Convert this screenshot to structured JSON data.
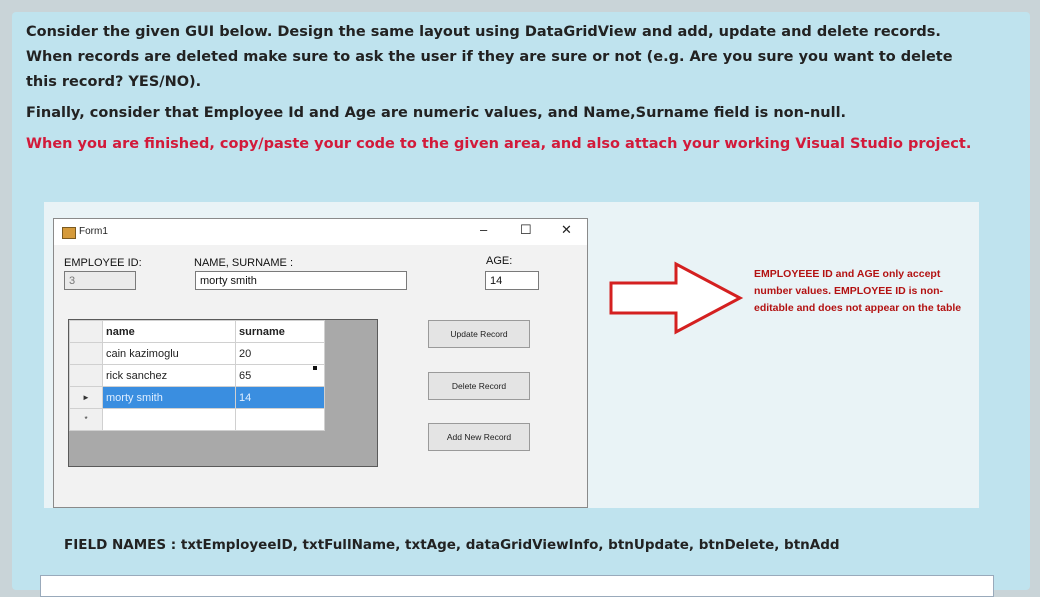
{
  "question": {
    "line1": "Consider the given GUI below. Design the same layout using DataGridView and add, update and delete records. When records are deleted make sure to ask the user if they are sure or not (e.g. Are you sure you want to delete this record? YES/NO).",
    "line2": "Finally, consider that Employee Id and Age are numeric values, and Name,Surname field is non-null.",
    "line3": "When you are finished, copy/paste your code to the given area, and also attach your working Visual Studio project."
  },
  "form": {
    "title": "Form1",
    "minimize": "–",
    "maximize": "☐",
    "close": "✕",
    "employee_id_label": "EMPLOYEE ID:",
    "employee_id_value": "3",
    "name_label": "NAME, SURNAME :",
    "name_value": "morty smith",
    "age_label": "AGE:",
    "age_value": "14",
    "grid": {
      "headers": [
        "name",
        "surname"
      ],
      "rows": [
        [
          "cain kazimoglu",
          "20"
        ],
        [
          "rick sanchez",
          "65"
        ],
        [
          "morty smith",
          "14"
        ],
        [
          "",
          ""
        ]
      ],
      "selected_marker": "►",
      "new_row_marker": "*"
    },
    "buttons": {
      "update": "Update Record",
      "delete": "Delete Record",
      "add": "Add New Record"
    }
  },
  "note": "EMPLOYEEE ID and AGE only accept number values. EMPLOYEE ID is non-editable and does not appear on the table",
  "field_names": "FIELD NAMES : txtEmployeeID, txtFullName, txtAge, dataGridViewInfo, btnUpdate, btnDelete, btnAdd",
  "colors": {
    "accent_red": "#d21a3a",
    "arrow_red": "#d42020",
    "selection_blue": "#3a8ee0"
  }
}
